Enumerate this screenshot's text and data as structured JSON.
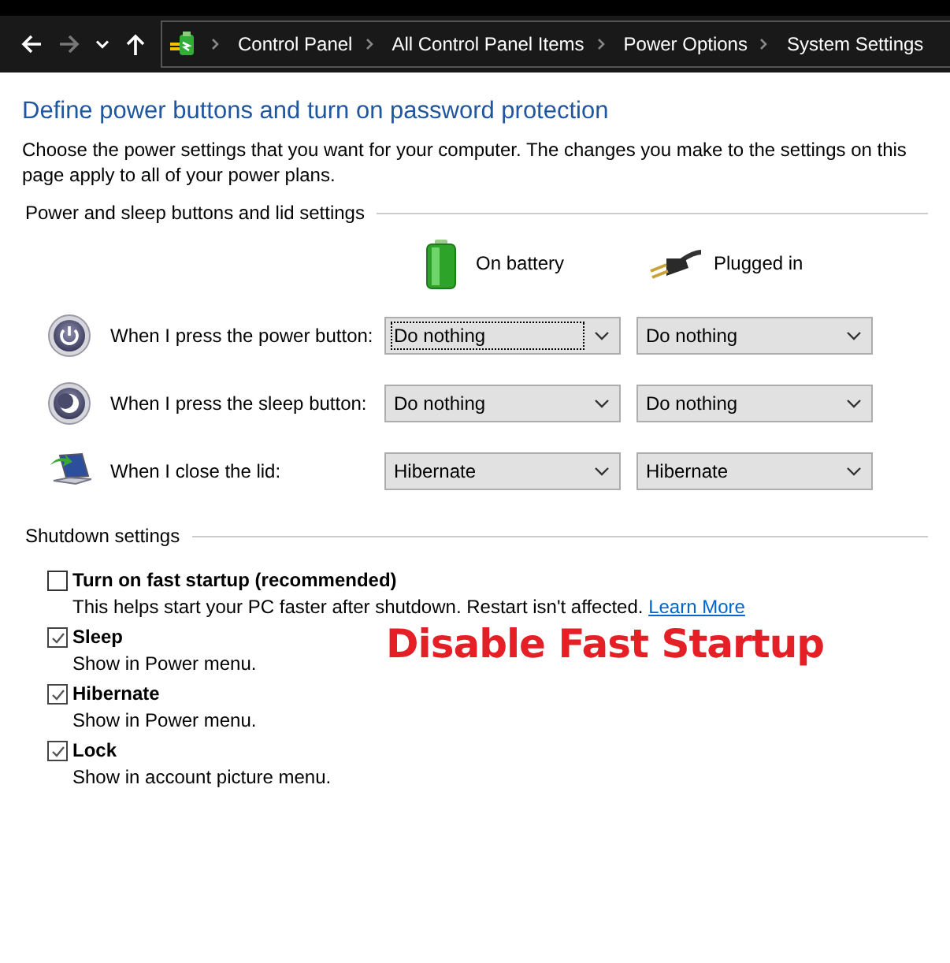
{
  "navigation": {
    "buttons": [
      {
        "kind": "back",
        "disabled": false
      },
      {
        "kind": "forward",
        "disabled": true
      },
      {
        "kind": "recent",
        "disabled": false
      },
      {
        "kind": "up",
        "disabled": false
      }
    ],
    "breadcrumb": [
      "Control Panel",
      "All Control Panel Items",
      "Power Options",
      "System Settings"
    ]
  },
  "page": {
    "title": "Define power buttons and turn on password protection",
    "description": "Choose the power settings that you want for your computer. The changes you make to the settings on this page apply to all of your power plans."
  },
  "power_section": {
    "heading": "Power and sleep buttons and lid settings",
    "columns": [
      {
        "kind": "battery",
        "label": "On battery"
      },
      {
        "kind": "plug",
        "label": "Plugged in"
      }
    ],
    "rows": [
      {
        "kind": "power",
        "label": "When I press the power button:",
        "values": [
          {
            "value": "Do nothing",
            "focused": true
          },
          {
            "value": "Do nothing",
            "focused": false
          }
        ]
      },
      {
        "kind": "sleep",
        "label": "When I press the sleep button:",
        "values": [
          {
            "value": "Do nothing",
            "focused": false
          },
          {
            "value": "Do nothing",
            "focused": false
          }
        ]
      },
      {
        "kind": "lid",
        "label": "When I close the lid:",
        "values": [
          {
            "value": "Hibernate",
            "focused": false
          },
          {
            "value": "Hibernate",
            "focused": false
          }
        ]
      }
    ]
  },
  "shutdown_section": {
    "heading": "Shutdown settings",
    "options": [
      {
        "label": "Turn on fast startup (recommended)",
        "checked": false,
        "description": "This helps start your PC faster after shutdown. Restart isn't affected.",
        "link": "Learn More"
      },
      {
        "label": "Sleep",
        "checked": true,
        "description": "Show in Power menu."
      },
      {
        "label": "Hibernate",
        "checked": true,
        "description": "Show in Power menu."
      },
      {
        "label": "Lock",
        "checked": true,
        "description": "Show in account picture menu."
      }
    ]
  },
  "annotation": "Disable Fast Startup"
}
